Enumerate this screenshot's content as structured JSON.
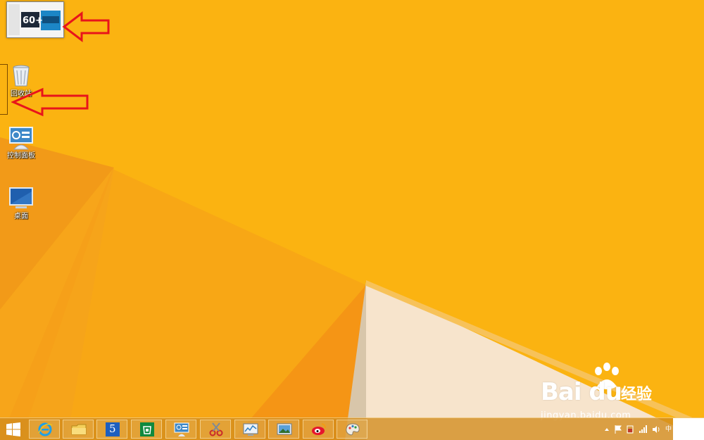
{
  "wallpaper": {
    "base_color": "#fbb311",
    "accent_light": "#f7e7cf",
    "accent_orange": "#f18b1b"
  },
  "desktop_icons": [
    {
      "name": "this-pc",
      "label": "",
      "icon": "computer-icon"
    },
    {
      "name": "recycle-bin",
      "label": "回收站",
      "icon": "recycle-bin-icon"
    },
    {
      "name": "control-panel",
      "label": "控制面板",
      "icon": "control-panel-icon"
    },
    {
      "name": "desktop",
      "label": "桌面",
      "icon": "monitor-icon"
    }
  ],
  "thumbnail": {
    "text": "60+"
  },
  "annotations": {
    "arrow_color": "#e8141b"
  },
  "taskbar": {
    "buttons": [
      {
        "name": "internet-explorer",
        "icon": "ie-icon"
      },
      {
        "name": "file-explorer",
        "icon": "folder-icon"
      },
      {
        "name": "app-5",
        "icon": "number-5-icon",
        "text": "5"
      },
      {
        "name": "store",
        "icon": "store-icon"
      },
      {
        "name": "control-panel",
        "icon": "control-panel-icon"
      },
      {
        "name": "snipping-tool",
        "icon": "scissors-icon"
      },
      {
        "name": "performance-monitor",
        "icon": "chart-icon"
      },
      {
        "name": "photos",
        "icon": "picture-icon"
      },
      {
        "name": "weibo",
        "icon": "weibo-icon"
      },
      {
        "name": "paint",
        "icon": "palette-icon"
      }
    ],
    "tray": {
      "ime": "中"
    }
  },
  "watermark": {
    "brand": "Bai du",
    "suffix": "经验",
    "url": "jingyan.baidu.com"
  }
}
